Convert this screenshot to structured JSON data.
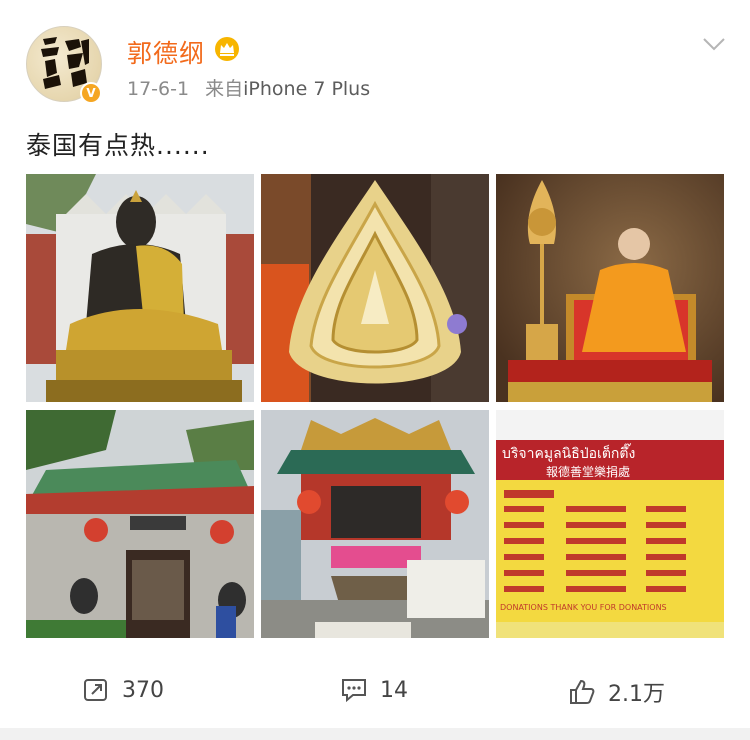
{
  "user": {
    "name": "郭德纲",
    "date": "17-6-1",
    "source_prefix": "来自",
    "device": "iPhone 7 Plus",
    "verified_badge": "V"
  },
  "post": {
    "text": "泰国有点热......"
  },
  "images": [
    {
      "name": "golden-buddha-statue-photo"
    },
    {
      "name": "gold-leaf-ornament-photo"
    },
    {
      "name": "monk-portrait-photo"
    },
    {
      "name": "chinese-temple-gate-photo"
    },
    {
      "name": "shrine-incense-photo"
    },
    {
      "name": "donation-board-photo",
      "texts": [
        "บริจาคมูลนิธิป่อเต็กตึ๊ง",
        "報德善堂樂捐處",
        "DONATIONS THANK YOU FOR DONATIONS"
      ]
    }
  ],
  "actions": {
    "repost_count": "370",
    "comment_count": "14",
    "like_count": "2.1万"
  },
  "colors": {
    "username": "#f26a1b",
    "meta": "#8a8a8a",
    "badge": "#f5a623"
  },
  "icons": [
    "crown-icon",
    "chevron-down-icon",
    "repost-icon",
    "comment-icon",
    "like-icon",
    "verified-icon"
  ]
}
